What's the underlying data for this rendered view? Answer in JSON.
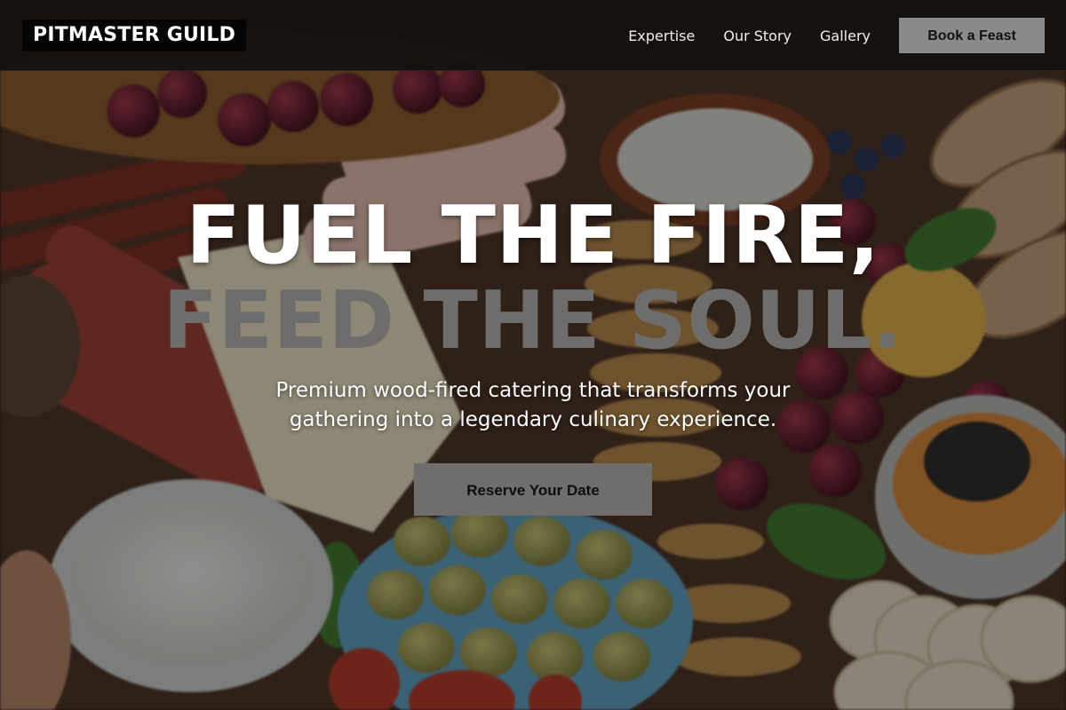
{
  "navbar": {
    "brand": "PITMASTER GUILD",
    "links": [
      "Expertise",
      "Our Story",
      "Gallery"
    ],
    "cta_label": "Book a Feast"
  },
  "hero": {
    "headline_line1": "FUEL THE FIRE,",
    "headline_line2": "FEED THE SOUL.",
    "subtext": "Premium wood-fired catering that transforms your gathering into a legendary culinary experience.",
    "cta_label": "Reserve Your Date",
    "background_image": "charcuterie-board-photo"
  },
  "colors": {
    "nav_bg": "#12100f",
    "brand_bg": "#050505",
    "cta_bg": "#8a8a8a",
    "hero_cta_bg": "#6f6e6d",
    "headline_primary": "#ffffff",
    "headline_secondary": "#6f6d6c"
  }
}
